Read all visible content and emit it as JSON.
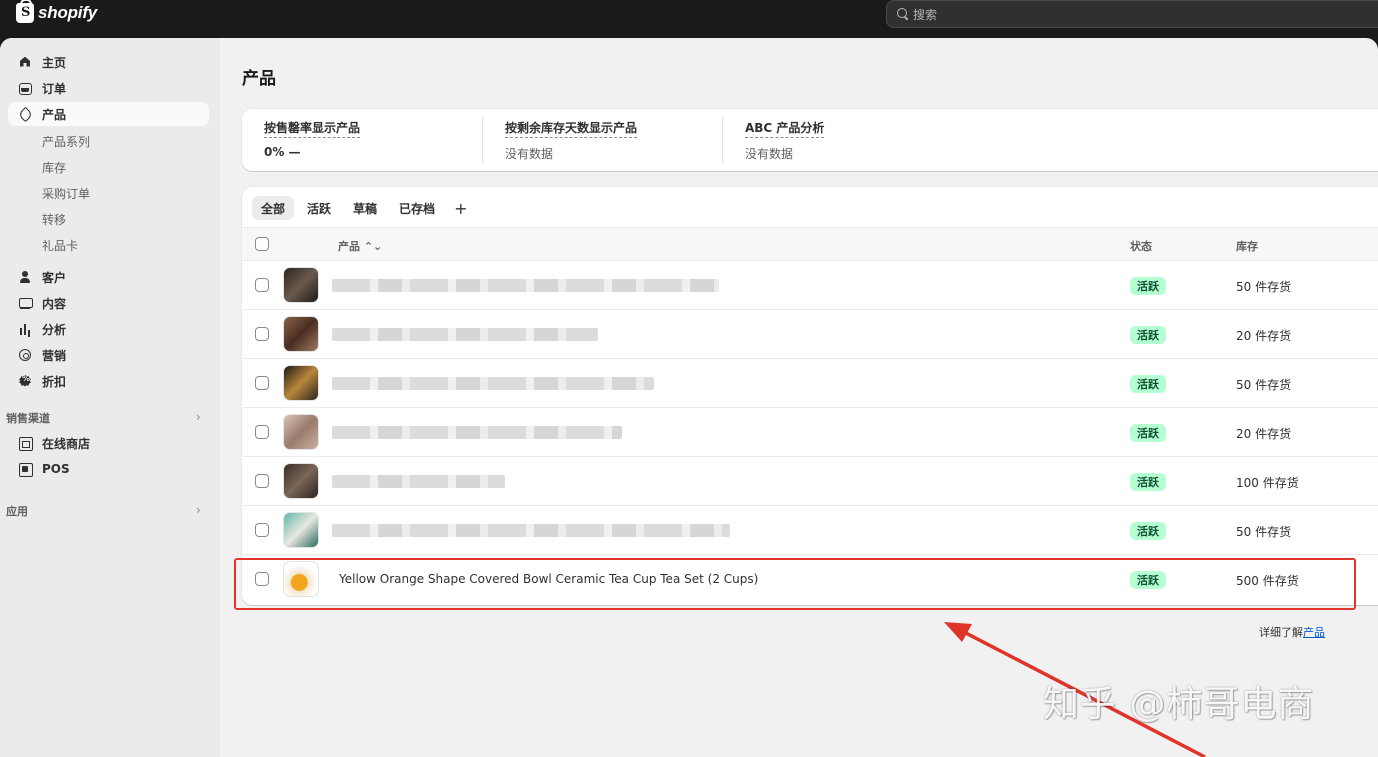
{
  "header": {
    "logo_text": "shopify",
    "logo_glyph": "S",
    "search_placeholder": "搜索"
  },
  "sidebar": {
    "items": [
      {
        "label": "主页",
        "icon": "home-icon"
      },
      {
        "label": "订单",
        "icon": "inbox-icon"
      },
      {
        "label": "产品",
        "icon": "tag-icon",
        "active": true
      }
    ],
    "product_sub": [
      "产品系列",
      "库存",
      "采购订单",
      "转移",
      "礼品卡"
    ],
    "items2": [
      {
        "label": "客户",
        "icon": "person-icon"
      },
      {
        "label": "内容",
        "icon": "content-icon"
      },
      {
        "label": "分析",
        "icon": "chart-icon"
      },
      {
        "label": "营销",
        "icon": "target-icon"
      },
      {
        "label": "折扣",
        "icon": "discount-icon"
      }
    ],
    "sales_channels_label": "销售渠道",
    "channels": [
      {
        "label": "在线商店",
        "icon": "store-icon"
      },
      {
        "label": "POS",
        "icon": "pos-icon"
      }
    ],
    "apps_label": "应用",
    "chevron": "›"
  },
  "main": {
    "title": "产品",
    "metrics": [
      {
        "label": "按售罄率显示产品",
        "value": "0% —"
      },
      {
        "label": "按剩余库存天数显示产品",
        "value": "没有数据"
      },
      {
        "label": "ABC 产品分析",
        "value": "没有数据"
      }
    ],
    "tabs": [
      "全部",
      "活跃",
      "草稿",
      "已存档"
    ],
    "add_tab": "+",
    "columns": {
      "product": "产品 ⌃⌄",
      "status": "状态",
      "inventory": "库存"
    },
    "rows": [
      {
        "name": "",
        "status": "活跃",
        "inventory": "50 件存货"
      },
      {
        "name": "",
        "status": "活跃",
        "inventory": "20 件存货"
      },
      {
        "name": "",
        "status": "活跃",
        "inventory": "50 件存货"
      },
      {
        "name": "",
        "status": "活跃",
        "inventory": "20 件存货"
      },
      {
        "name": "",
        "status": "活跃",
        "inventory": "100 件存货"
      },
      {
        "name": "",
        "status": "活跃",
        "inventory": "50 件存货"
      },
      {
        "name": "Yellow Orange Shape Covered Bowl Ceramic Tea Cup Tea Set (2 Cups)",
        "status": "活跃",
        "inventory": "500 件存货"
      }
    ],
    "learn_more_prefix": "详细了解",
    "learn_more_link": "产品"
  },
  "overlay": {
    "watermark": "知乎 @柿哥电商",
    "highlight_color": "#e0342b"
  },
  "colors": {
    "topbar": "#1a1a1a",
    "badge_bg": "#b4fed2",
    "badge_text": "#0c5132",
    "link": "#005bd3"
  }
}
